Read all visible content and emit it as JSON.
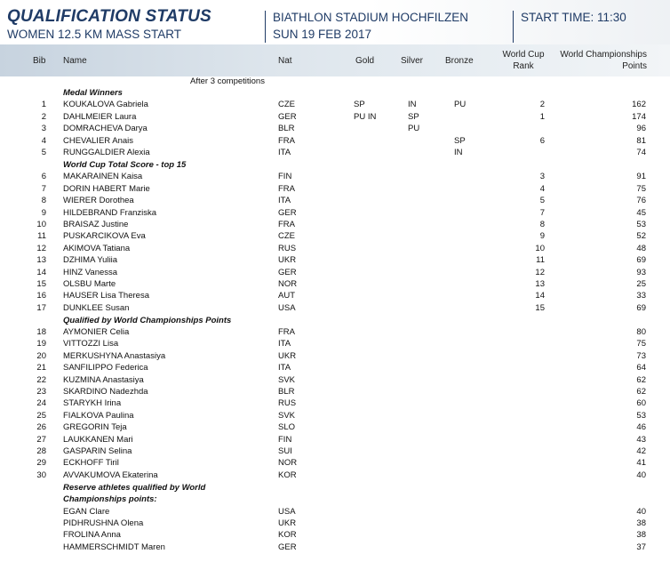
{
  "header": {
    "title": "QUALIFICATION STATUS",
    "subtitle": "WOMEN 12.5 KM MASS START",
    "venue": "BIATHLON STADIUM HOCHFILZEN",
    "date": "SUN 19 FEB 2017",
    "start_time": "START TIME:  11:30"
  },
  "columns": {
    "bib": "Bib",
    "name": "Name",
    "nat": "Nat",
    "gold": "Gold",
    "silver": "Silver",
    "bronze": "Bronze",
    "wc_rank_1": "World Cup",
    "wc_rank_2": "Rank",
    "wch_pts_1": "World Championships",
    "wch_pts_2": "Points"
  },
  "after_note": "After 3 competitions",
  "sections": [
    {
      "title": "Medal Winners",
      "rows": [
        {
          "bib": "1",
          "name": "KOUKALOVA Gabriela",
          "nat": "CZE",
          "gold": "SP",
          "silver": "IN",
          "bronze": "PU",
          "rank": "2",
          "points": "162"
        },
        {
          "bib": "2",
          "name": "DAHLMEIER Laura",
          "nat": "GER",
          "gold": "PU IN",
          "silver": "SP",
          "bronze": "",
          "rank": "1",
          "points": "174"
        },
        {
          "bib": "3",
          "name": "DOMRACHEVA Darya",
          "nat": "BLR",
          "gold": "",
          "silver": "PU",
          "bronze": "",
          "rank": "",
          "points": "96"
        },
        {
          "bib": "4",
          "name": "CHEVALIER Anais",
          "nat": "FRA",
          "gold": "",
          "silver": "",
          "bronze": "SP",
          "rank": "6",
          "points": "81"
        },
        {
          "bib": "5",
          "name": "RUNGGALDIER Alexia",
          "nat": "ITA",
          "gold": "",
          "silver": "",
          "bronze": "IN",
          "rank": "",
          "points": "74"
        }
      ]
    },
    {
      "title": "World Cup Total Score - top 15",
      "rows": [
        {
          "bib": "6",
          "name": "MAKARAINEN Kaisa",
          "nat": "FIN",
          "gold": "",
          "silver": "",
          "bronze": "",
          "rank": "3",
          "points": "91"
        },
        {
          "bib": "7",
          "name": "DORIN HABERT Marie",
          "nat": "FRA",
          "gold": "",
          "silver": "",
          "bronze": "",
          "rank": "4",
          "points": "75"
        },
        {
          "bib": "8",
          "name": "WIERER Dorothea",
          "nat": "ITA",
          "gold": "",
          "silver": "",
          "bronze": "",
          "rank": "5",
          "points": "76"
        },
        {
          "bib": "9",
          "name": "HILDEBRAND Franziska",
          "nat": "GER",
          "gold": "",
          "silver": "",
          "bronze": "",
          "rank": "7",
          "points": "45"
        },
        {
          "bib": "10",
          "name": "BRAISAZ Justine",
          "nat": "FRA",
          "gold": "",
          "silver": "",
          "bronze": "",
          "rank": "8",
          "points": "53"
        },
        {
          "bib": "11",
          "name": "PUSKARCIKOVA Eva",
          "nat": "CZE",
          "gold": "",
          "silver": "",
          "bronze": "",
          "rank": "9",
          "points": "52"
        },
        {
          "bib": "12",
          "name": "AKIMOVA Tatiana",
          "nat": "RUS",
          "gold": "",
          "silver": "",
          "bronze": "",
          "rank": "10",
          "points": "48"
        },
        {
          "bib": "13",
          "name": "DZHIMA Yuliia",
          "nat": "UKR",
          "gold": "",
          "silver": "",
          "bronze": "",
          "rank": "11",
          "points": "69"
        },
        {
          "bib": "14",
          "name": "HINZ Vanessa",
          "nat": "GER",
          "gold": "",
          "silver": "",
          "bronze": "",
          "rank": "12",
          "points": "93"
        },
        {
          "bib": "15",
          "name": "OLSBU Marte",
          "nat": "NOR",
          "gold": "",
          "silver": "",
          "bronze": "",
          "rank": "13",
          "points": "25"
        },
        {
          "bib": "16",
          "name": "HAUSER Lisa Theresa",
          "nat": "AUT",
          "gold": "",
          "silver": "",
          "bronze": "",
          "rank": "14",
          "points": "33"
        },
        {
          "bib": "17",
          "name": "DUNKLEE Susan",
          "nat": "USA",
          "gold": "",
          "silver": "",
          "bronze": "",
          "rank": "15",
          "points": "69"
        }
      ]
    },
    {
      "title": "Qualified by World Championships Points",
      "rows": [
        {
          "bib": "18",
          "name": "AYMONIER Celia",
          "nat": "FRA",
          "gold": "",
          "silver": "",
          "bronze": "",
          "rank": "",
          "points": "80"
        },
        {
          "bib": "19",
          "name": "VITTOZZI Lisa",
          "nat": "ITA",
          "gold": "",
          "silver": "",
          "bronze": "",
          "rank": "",
          "points": "75"
        },
        {
          "bib": "20",
          "name": "MERKUSHYNA  Anastasiya",
          "nat": "UKR",
          "gold": "",
          "silver": "",
          "bronze": "",
          "rank": "",
          "points": "73"
        },
        {
          "bib": "21",
          "name": "SANFILIPPO Federica",
          "nat": "ITA",
          "gold": "",
          "silver": "",
          "bronze": "",
          "rank": "",
          "points": "64"
        },
        {
          "bib": "22",
          "name": "KUZMINA Anastasiya",
          "nat": "SVK",
          "gold": "",
          "silver": "",
          "bronze": "",
          "rank": "",
          "points": "62"
        },
        {
          "bib": "23",
          "name": "SKARDINO Nadezhda",
          "nat": "BLR",
          "gold": "",
          "silver": "",
          "bronze": "",
          "rank": "",
          "points": "62"
        },
        {
          "bib": "24",
          "name": "STARYKH Irina",
          "nat": "RUS",
          "gold": "",
          "silver": "",
          "bronze": "",
          "rank": "",
          "points": "60"
        },
        {
          "bib": "25",
          "name": "FIALKOVA Paulina",
          "nat": "SVK",
          "gold": "",
          "silver": "",
          "bronze": "",
          "rank": "",
          "points": "53"
        },
        {
          "bib": "26",
          "name": "GREGORIN Teja",
          "nat": "SLO",
          "gold": "",
          "silver": "",
          "bronze": "",
          "rank": "",
          "points": "46"
        },
        {
          "bib": "27",
          "name": "LAUKKANEN Mari",
          "nat": "FIN",
          "gold": "",
          "silver": "",
          "bronze": "",
          "rank": "",
          "points": "43"
        },
        {
          "bib": "28",
          "name": "GASPARIN Selina",
          "nat": "SUI",
          "gold": "",
          "silver": "",
          "bronze": "",
          "rank": "",
          "points": "42"
        },
        {
          "bib": "29",
          "name": "ECKHOFF Tiril",
          "nat": "NOR",
          "gold": "",
          "silver": "",
          "bronze": "",
          "rank": "",
          "points": "41"
        },
        {
          "bib": "30",
          "name": "AVVAKUMOVA Ekaterina",
          "nat": "KOR",
          "gold": "",
          "silver": "",
          "bronze": "",
          "rank": "",
          "points": "40"
        }
      ]
    },
    {
      "title": "Reserve athletes qualified by World",
      "title2": "Championships points:",
      "rows": [
        {
          "bib": "",
          "name": "EGAN Clare",
          "nat": "USA",
          "gold": "",
          "silver": "",
          "bronze": "",
          "rank": "",
          "points": "40"
        },
        {
          "bib": "",
          "name": "PIDHRUSHNA Olena",
          "nat": "UKR",
          "gold": "",
          "silver": "",
          "bronze": "",
          "rank": "",
          "points": "38"
        },
        {
          "bib": "",
          "name": "FROLINA Anna",
          "nat": "KOR",
          "gold": "",
          "silver": "",
          "bronze": "",
          "rank": "",
          "points": "38"
        },
        {
          "bib": "",
          "name": "HAMMERSCHMIDT Maren",
          "nat": "GER",
          "gold": "",
          "silver": "",
          "bronze": "",
          "rank": "",
          "points": "37"
        }
      ]
    }
  ]
}
